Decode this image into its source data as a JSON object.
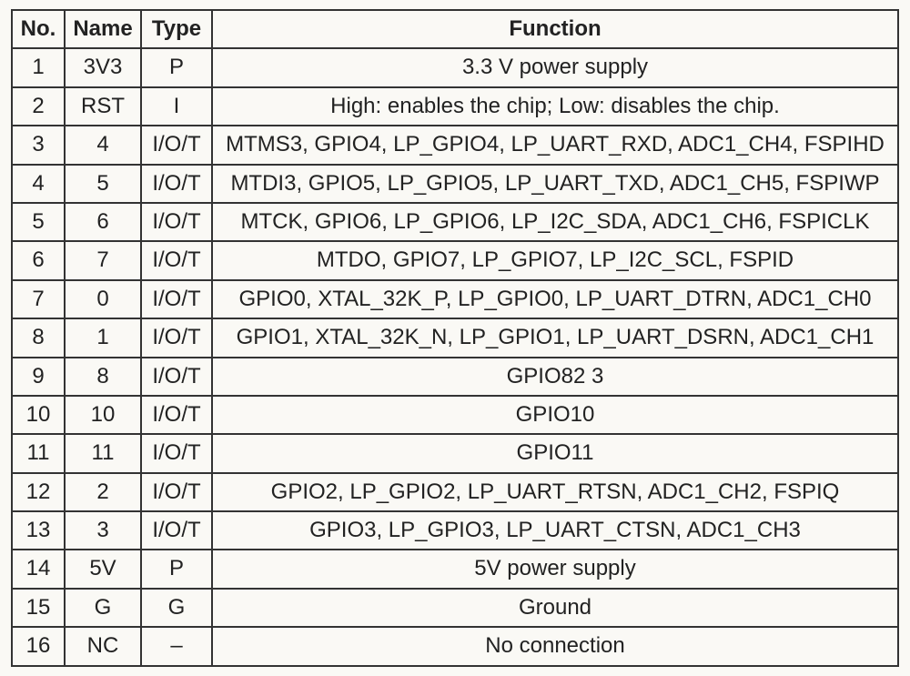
{
  "headers": {
    "no": "No.",
    "name": "Name",
    "type": "Type",
    "function": "Function"
  },
  "rows": [
    {
      "no": "1",
      "name": "3V3",
      "type": "P",
      "function": "3.3 V power supply"
    },
    {
      "no": "2",
      "name": "RST",
      "type": "I",
      "function": "High: enables the chip; Low: disables the chip."
    },
    {
      "no": "3",
      "name": "4",
      "type": "I/O/T",
      "function": "MTMS3, GPIO4, LP_GPIO4, LP_UART_RXD, ADC1_CH4, FSPIHD"
    },
    {
      "no": "4",
      "name": "5",
      "type": "I/O/T",
      "function": "MTDI3, GPIO5, LP_GPIO5, LP_UART_TXD, ADC1_CH5, FSPIWP"
    },
    {
      "no": "5",
      "name": "6",
      "type": "I/O/T",
      "function": "MTCK, GPIO6, LP_GPIO6, LP_I2C_SDA, ADC1_CH6, FSPICLK"
    },
    {
      "no": "6",
      "name": "7",
      "type": "I/O/T",
      "function": "MTDO, GPIO7, LP_GPIO7, LP_I2C_SCL, FSPID"
    },
    {
      "no": "7",
      "name": "0",
      "type": "I/O/T",
      "function": "GPIO0, XTAL_32K_P, LP_GPIO0, LP_UART_DTRN, ADC1_CH0"
    },
    {
      "no": "8",
      "name": "1",
      "type": "I/O/T",
      "function": "GPIO1, XTAL_32K_N, LP_GPIO1, LP_UART_DSRN, ADC1_CH1"
    },
    {
      "no": "9",
      "name": "8",
      "type": "I/O/T",
      "function": "GPIO82 3"
    },
    {
      "no": "10",
      "name": "10",
      "type": "I/O/T",
      "function": "GPIO10"
    },
    {
      "no": "11",
      "name": "11",
      "type": "I/O/T",
      "function": "GPIO11"
    },
    {
      "no": "12",
      "name": "2",
      "type": "I/O/T",
      "function": "GPIO2, LP_GPIO2, LP_UART_RTSN, ADC1_CH2, FSPIQ"
    },
    {
      "no": "13",
      "name": "3",
      "type": "I/O/T",
      "function": "GPIO3, LP_GPIO3, LP_UART_CTSN, ADC1_CH3"
    },
    {
      "no": "14",
      "name": "5V",
      "type": "P",
      "function": "5V power supply"
    },
    {
      "no": "15",
      "name": "G",
      "type": "G",
      "function": "Ground"
    },
    {
      "no": "16",
      "name": "NC",
      "type": "–",
      "function": "No connection"
    }
  ]
}
